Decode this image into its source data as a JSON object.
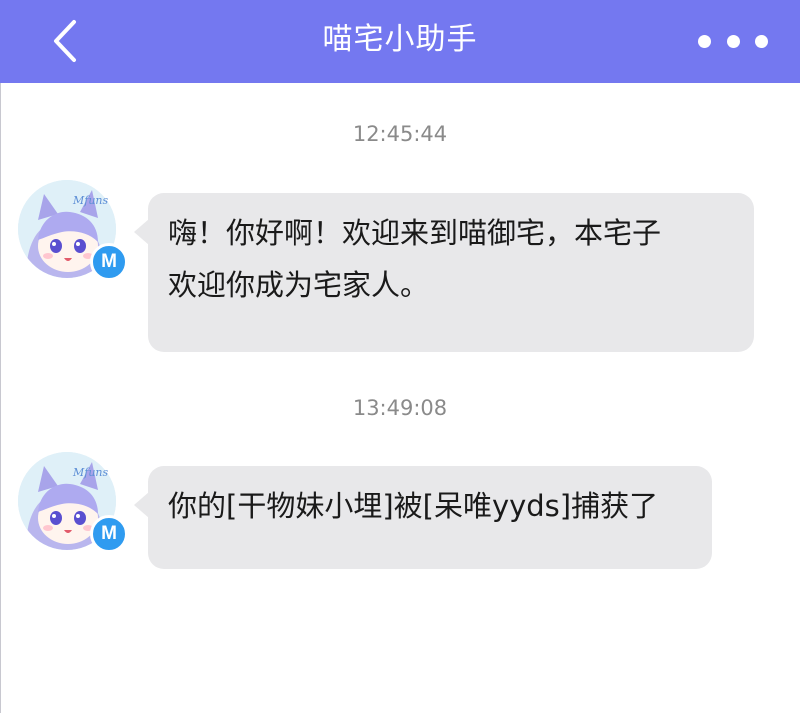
{
  "header": {
    "title": "喵宅小助手",
    "back_icon": "chevron-left-icon",
    "more_icon": "more-horizontal-icon",
    "background": "#7478f0"
  },
  "messages": [
    {
      "time": "12:45:44",
      "avatar_text": "Mfuns",
      "badge": "M",
      "text_line1": "嗨！你好啊！欢迎来到喵御宅，本宅子",
      "text_line2": "欢迎你成为宅家人。"
    },
    {
      "time": "13:49:08",
      "avatar_text": "Mfuns",
      "badge": "M",
      "text_line1": "你的[干物妹小埋]被[呆唯yyds]捕获了"
    }
  ],
  "colors": {
    "bubble": "#e8e8ea",
    "badge": "#2f9bf0",
    "timestamp": "#8a8a8a"
  }
}
